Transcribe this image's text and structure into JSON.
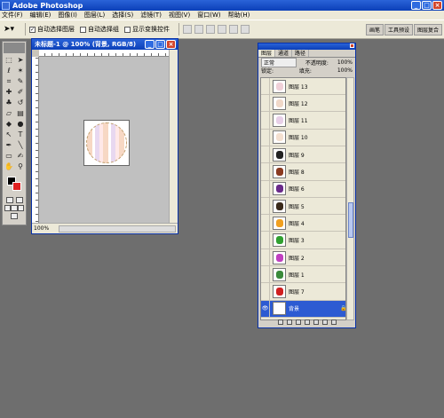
{
  "app": {
    "title": "Adobe Photoshop"
  },
  "menu": [
    "文件(F)",
    "编辑(E)",
    "图像(I)",
    "图层(L)",
    "选择(S)",
    "滤镜(T)",
    "视图(V)",
    "窗口(W)",
    "帮助(H)"
  ],
  "options": {
    "auto_select_layer": "自动选择图层",
    "auto_select_group": "自动选择组",
    "show_transform": "显示变换控件",
    "well_tabs": [
      "画笔",
      "工具预设",
      "图层复合"
    ]
  },
  "document": {
    "title": "未标题-1 @ 100% (背景, RGB/8)",
    "zoom": "100%"
  },
  "layers_panel": {
    "tabs": [
      "图层",
      "通道",
      "路径"
    ],
    "blend_mode": "正常",
    "opacity_label": "不透明度:",
    "opacity_value": "100%",
    "lock_label": "锁定:",
    "fill_label": "填充:",
    "fill_value": "100%",
    "layers": [
      {
        "name": "图层 13",
        "color": "#f0d0d8"
      },
      {
        "name": "图层 12",
        "color": "#f0d8c8"
      },
      {
        "name": "图层 11",
        "color": "#e8d0e8"
      },
      {
        "name": "图层 10",
        "color": "#f4e0d0"
      },
      {
        "name": "图层 9",
        "color": "#222222"
      },
      {
        "name": "图层 8",
        "color": "#8a3a20"
      },
      {
        "name": "图层 6",
        "color": "#6a2a8a"
      },
      {
        "name": "图层 5",
        "color": "#3a2a1a"
      },
      {
        "name": "图层 4",
        "color": "#f0a020"
      },
      {
        "name": "图层 3",
        "color": "#30a030"
      },
      {
        "name": "图层 2",
        "color": "#c040c0"
      },
      {
        "name": "图层 1",
        "color": "#3a8a3a"
      },
      {
        "name": "图层 7",
        "color": "#d02020"
      },
      {
        "name": "背景",
        "color": "#ffffff"
      }
    ]
  }
}
